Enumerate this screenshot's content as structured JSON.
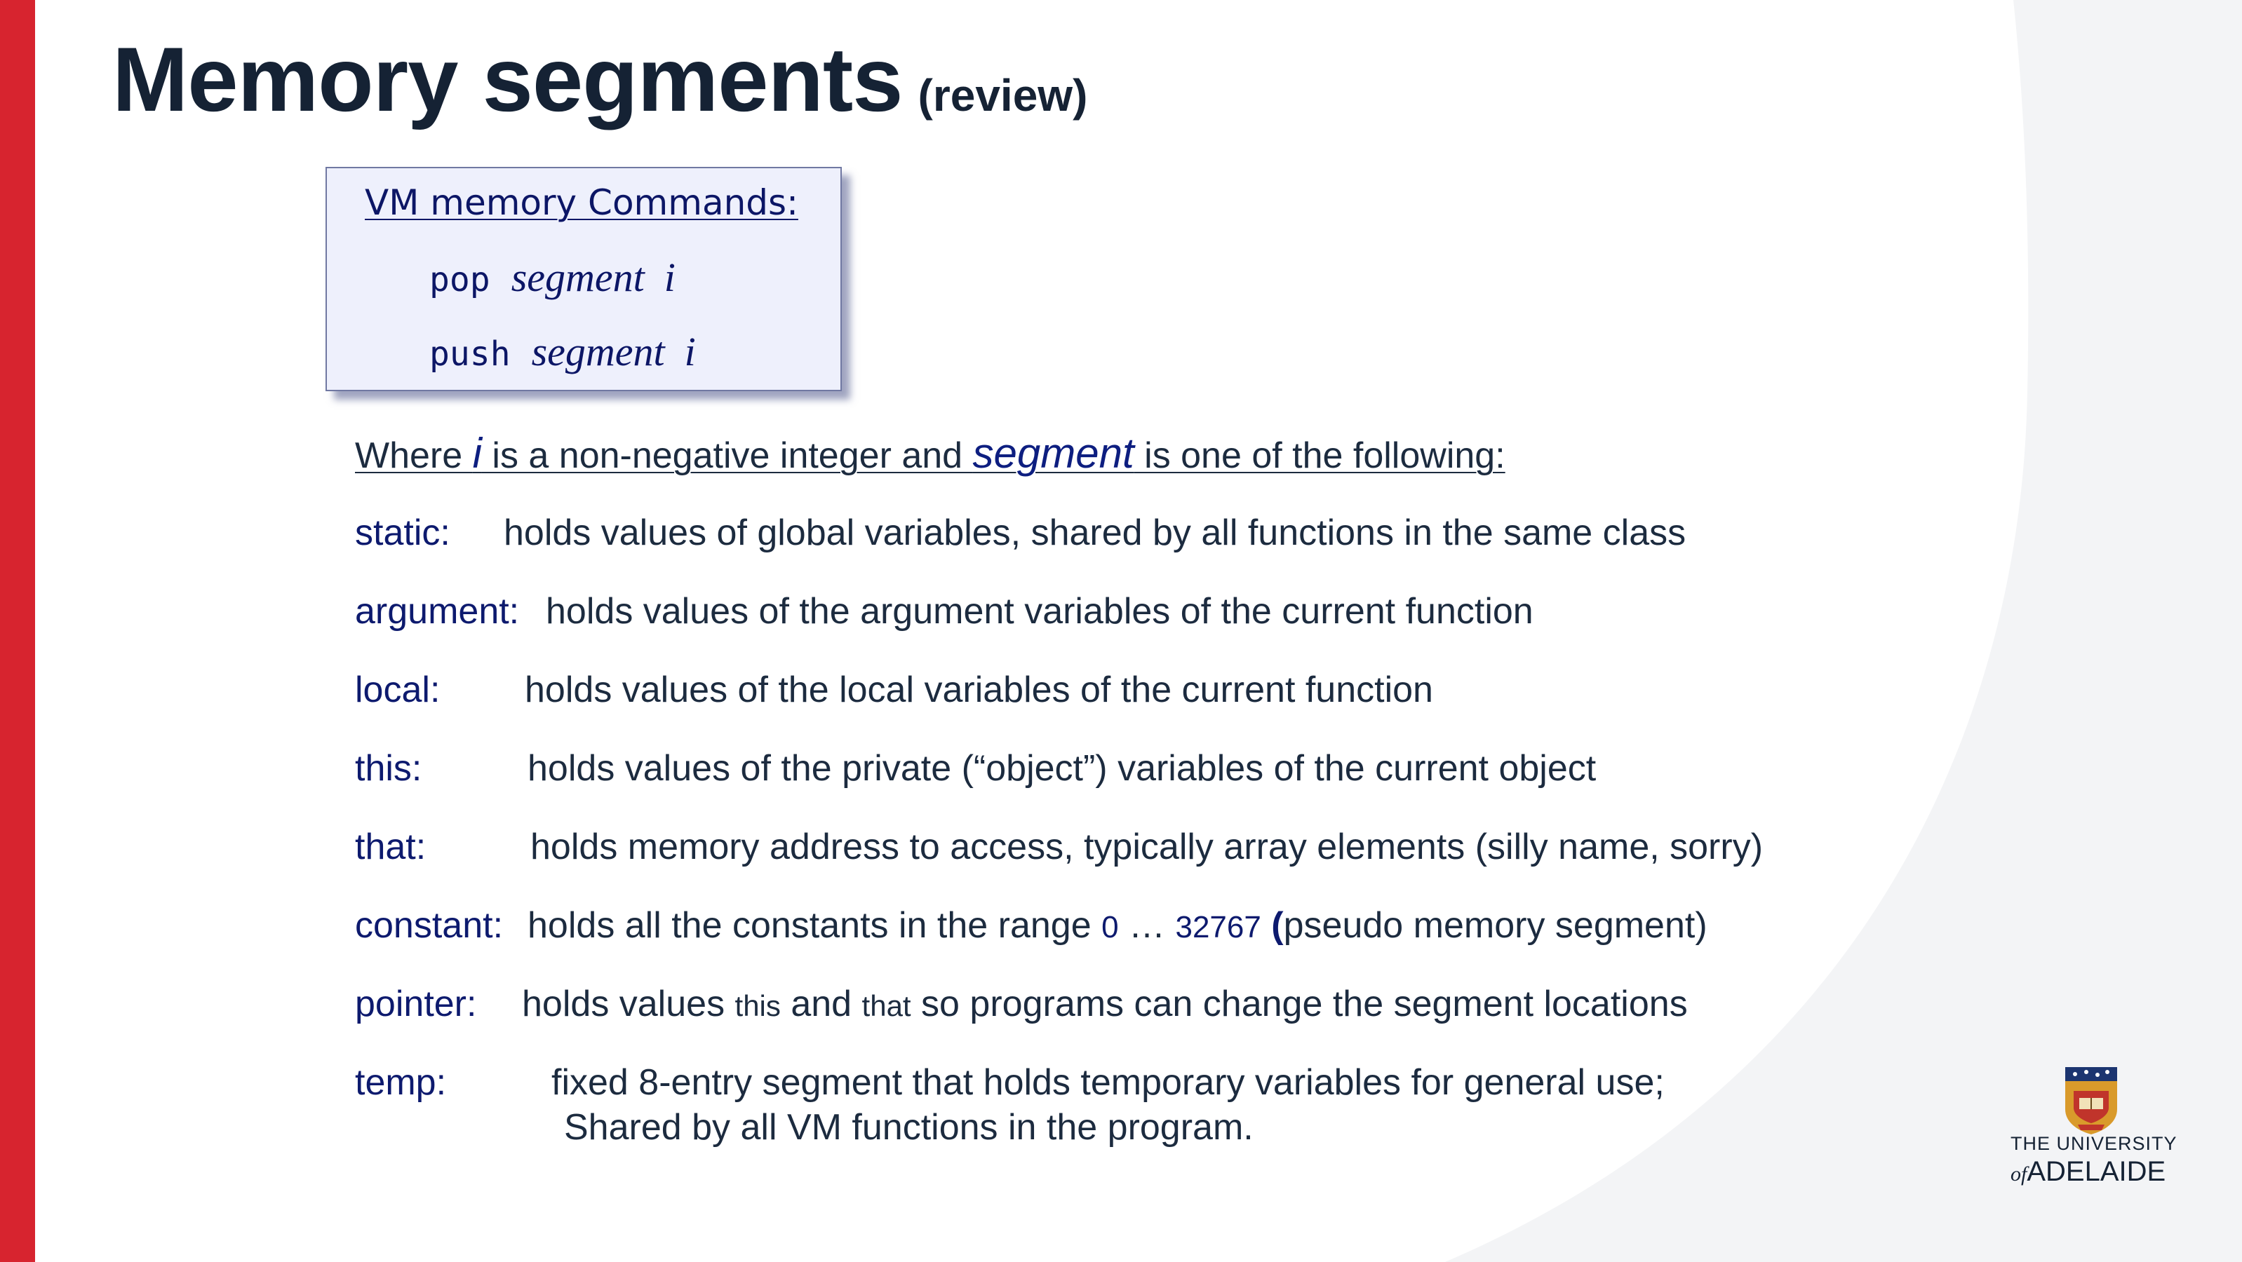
{
  "title": {
    "main": "Memory segments",
    "sub": "(review)"
  },
  "command_box": {
    "heading": "VM memory Commands:",
    "commands": [
      {
        "keyword": "pop",
        "segment": "segment",
        "index": "i"
      },
      {
        "keyword": "push",
        "segment": "segment",
        "index": "i"
      }
    ]
  },
  "intro": {
    "part1": "Where ",
    "i": "i",
    "part2": " is a non-negative integer and ",
    "segment": "segment",
    "part3": " is one of the following:"
  },
  "segments": {
    "static": {
      "name": "static:",
      "desc": "holds values of global variables, shared by all functions in the same class"
    },
    "argument": {
      "name": "argument:",
      "desc": "holds values of the argument variables of the current function"
    },
    "local": {
      "name": "local:",
      "desc": "holds values of the local variables of the current function"
    },
    "this": {
      "name": "this:",
      "desc": "holds values of the private (“object”) variables of the current object"
    },
    "that": {
      "name": "that:",
      "desc": "holds memory address to access, typically array elements (silly name, sorry)"
    },
    "constant": {
      "name": "constant:",
      "desc_before": "holds all the constants in the range ",
      "range_start": "0",
      "ellipsis": " … ",
      "range_end": "32767",
      "paren_open": " (",
      "desc_after": "pseudo memory segment)"
    },
    "pointer": {
      "name": "pointer:",
      "desc1": "holds values ",
      "this_word": "this",
      "and": " and ",
      "that_word": "that",
      "desc2": " so programs can change the segment locations"
    },
    "temp": {
      "name": "temp:",
      "desc_line1": "fixed 8-entry segment that holds temporary variables for general use;",
      "desc_line2": "Shared by all VM functions in the program."
    }
  },
  "logo": {
    "line1": "THE UNIVERSITY",
    "of": "of",
    "line2": "ADELAIDE",
    "icon": "university-crest-icon"
  },
  "colors": {
    "accent_bar": "#d7242f",
    "title": "#152234",
    "segment_name": "#0d1a6e",
    "box_bg": "#eef0fc"
  }
}
